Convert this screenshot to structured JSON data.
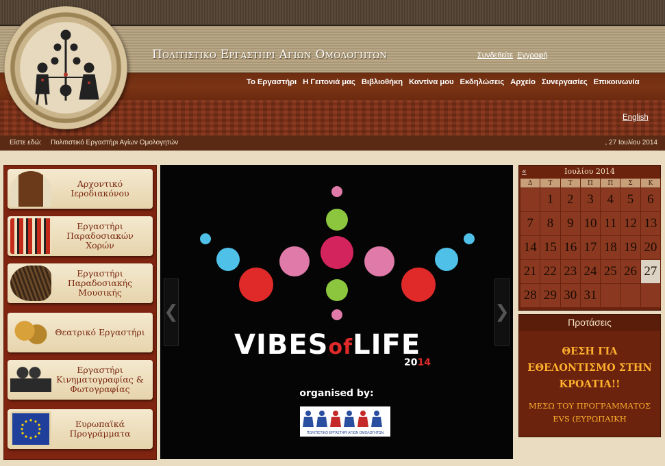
{
  "site": {
    "title": "Πολιτιστικο Εργαστηρι Αγιων Ομολογητων",
    "login": "Συνδεθείτε",
    "register": "Εγγραφή",
    "language_link": "English"
  },
  "nav": [
    "Το Εργαστήρι",
    "Η Γειτονιά μας",
    "Βιβλιοθήκη",
    "Καντίνα μου",
    "Εκδηλώσεις",
    "Αρχείο",
    "Συνεργασίες",
    "Επικοινωνία"
  ],
  "breadcrumb": {
    "label": "Είστε εδώ:",
    "text": "Πολιτιστικό Εργαστήρι Αγίων Ομολογητών",
    "date": ", 27 Ιουλίου 2014"
  },
  "sidebar": [
    {
      "label": "Αρχοντικό Ιεροδιακόνου",
      "icon": "door-icon"
    },
    {
      "label": "Εργαστήρι Παραδοσιακών Χορών",
      "icon": "dancers-icon"
    },
    {
      "label": "Εργαστήρι Παραδοσιακής Μουσικής",
      "icon": "drum-icon"
    },
    {
      "label": "Θεατρικό Εργαστήρι",
      "icon": "theater-masks-icon"
    },
    {
      "label": "Εργαστήρι Κινηματογραφίας & Φωτογραφίας",
      "icon": "film-camera-icon"
    },
    {
      "label": "Ευρωπαϊκά Προγράμματα",
      "icon": "eu-flag-icon"
    }
  ],
  "slide": {
    "vibes": "VIBES",
    "of": "of",
    "life": "LIFE",
    "year_a": "20",
    "year_b": "14",
    "organised": "organised by:",
    "org_logo_text": "ΠΟΛΙΤΙΣΤΙΚΟ ΕΡΓΑΣΤΗΡΙ ΑΓΙΩΝ ΟΜΟΛΟΓΗΤΩΝ",
    "colors": {
      "red": "#e02a2a",
      "pink": "#e07aa8",
      "magenta": "#d4245e",
      "green": "#8cc63f",
      "blue": "#4fc0e8"
    }
  },
  "calendar": {
    "prev": "«",
    "month": "Ιουλίου 2014",
    "weekdays": [
      "Δ",
      "Τ",
      "Τ",
      "Π",
      "Π",
      "Σ",
      "Κ"
    ],
    "weeks": [
      [
        "",
        "1",
        "2",
        "3",
        "4",
        "5",
        "6"
      ],
      [
        "7",
        "8",
        "9",
        "10",
        "11",
        "12",
        "13"
      ],
      [
        "14",
        "15",
        "16",
        "17",
        "18",
        "19",
        "20"
      ],
      [
        "21",
        "22",
        "23",
        "24",
        "25",
        "26",
        "27"
      ],
      [
        "28",
        "29",
        "30",
        "31",
        "",
        "",
        ""
      ]
    ],
    "today": "27"
  },
  "suggestions": {
    "title": "Προτάσεις",
    "headline": "ΘΕΣΗ ΓΙΑ ΕΘΕΛΟΝΤΙΣΜΟ ΣΤΗΝ ΚΡΟΑΤΙΑ!!",
    "sub": "ΜΕΣΩ ΤΟΥ ΠΡΟΓΡΑΜΜΑΤΟΣ EVS (ΕΥΡΩΠΑΙΚΗ"
  }
}
